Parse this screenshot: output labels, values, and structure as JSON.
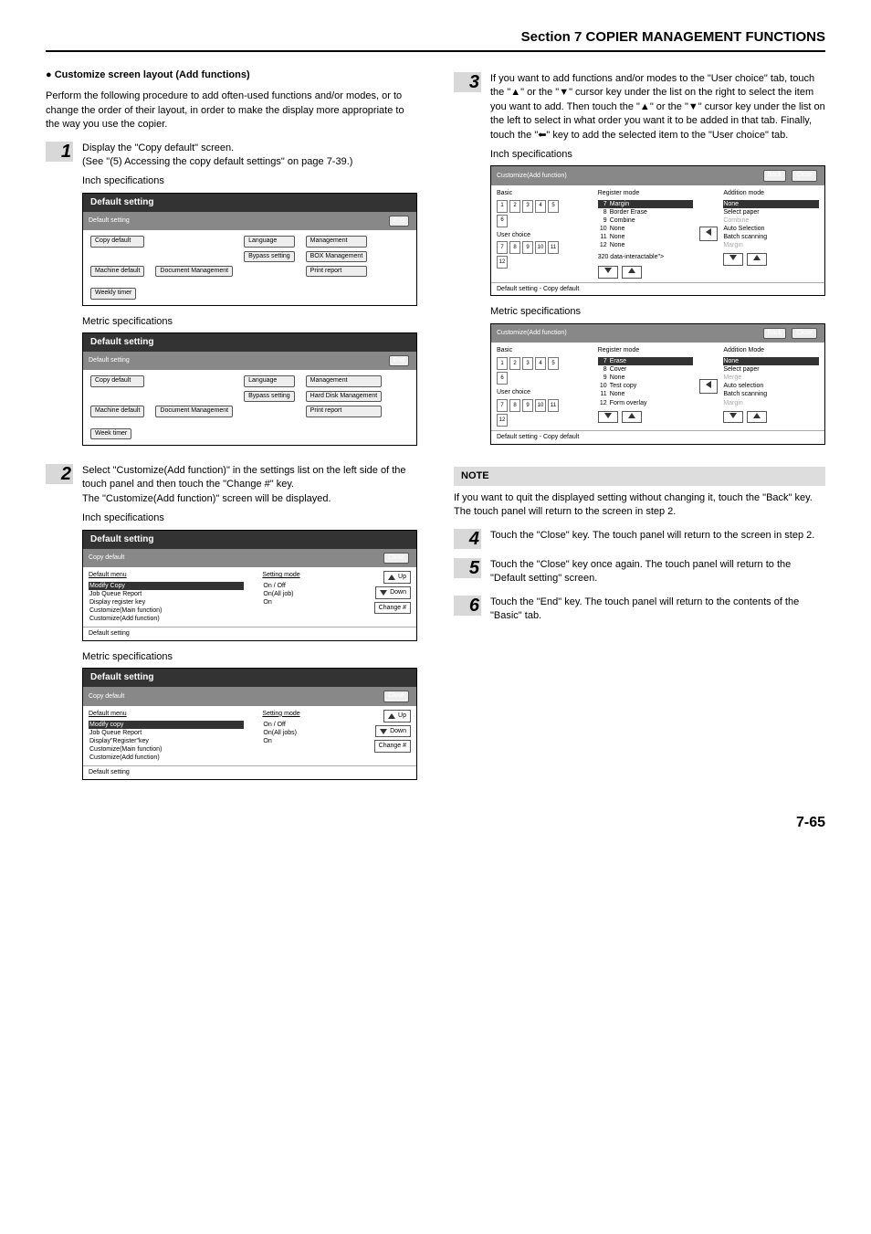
{
  "header": {
    "section_title": "Section 7  COPIER MANAGEMENT FUNCTIONS"
  },
  "left": {
    "heading": "Customize screen layout (Add functions)",
    "intro": "Perform the following procedure to add often-used functions and/or modes, or to change the order of their layout, in order to make the display more appropriate to the way you use the copier.",
    "step1": {
      "num": "1",
      "line1": "Display the \"Copy default\" screen.",
      "line2": "(See \"(5) Accessing the copy default settings\" on page 7-39.)",
      "inch_label": "Inch specifications",
      "metric_label": "Metric specifications"
    },
    "screen_a": {
      "title": "Default setting",
      "bar": "Default setting",
      "end": "End",
      "buttons": {
        "copy_default": "Copy default",
        "language": "Language",
        "bypass": "Bypass setting",
        "management": "Management",
        "box_mgmt": "BOX Management",
        "weekly": "Weekly timer",
        "machine": "Machine default",
        "document": "Document Management",
        "print": "Print report"
      }
    },
    "screen_b": {
      "title": "Default setting",
      "bar": "Default setting",
      "end": "End",
      "buttons": {
        "copy_default": "Copy default",
        "language": "Language",
        "bypass": "Bypass setting",
        "management": "Management",
        "hdd_mgmt": "Hard Disk Management",
        "week": "Week timer",
        "machine": "Machine default",
        "document": "Document Management",
        "print": "Print report"
      }
    },
    "step2": {
      "num": "2",
      "line1": "Select \"Customize(Add function)\" in the settings list on the left side of the touch panel and then touch the \"Change #\" key.",
      "line2": "The \"Customize(Add function)\" screen will be displayed.",
      "inch_label": "Inch specifications",
      "metric_label": "Metric specifications"
    },
    "screen_c": {
      "title": "Default setting",
      "bar": "Copy default",
      "close": "Close",
      "menu_hdr": "Default menu",
      "mode_hdr": "Setting mode",
      "items": [
        {
          "name": "Modify Copy",
          "mode": "On / Off",
          "sel": true
        },
        {
          "name": "Job Queue Report",
          "mode": "On(All job)",
          "sel": false
        },
        {
          "name": "Display register key",
          "mode": "On",
          "sel": false
        },
        {
          "name": "Customize(Main function)",
          "mode": "",
          "sel": false
        },
        {
          "name": "Customize(Add function)",
          "mode": "",
          "sel": false
        }
      ],
      "up": "Up",
      "down": "Down",
      "change": "Change #",
      "footer": "Default setting"
    },
    "screen_d": {
      "title": "Default setting",
      "bar": "Copy default",
      "close": "Close",
      "menu_hdr": "Default menu",
      "mode_hdr": "Setting mode",
      "items": [
        {
          "name": "Modify copy",
          "mode": "On / Off",
          "sel": true
        },
        {
          "name": "Job Queue Report",
          "mode": "On(All jobs)",
          "sel": false
        },
        {
          "name": "Display\"Register\"key",
          "mode": "On",
          "sel": false
        },
        {
          "name": "Customize(Main function)",
          "mode": "",
          "sel": false
        },
        {
          "name": "Customize(Add function)",
          "mode": "",
          "sel": false
        }
      ],
      "up": "Up",
      "down": "Down",
      "change": "Change #",
      "footer": "Default setting"
    }
  },
  "right": {
    "step3": {
      "num": "3",
      "text": "If you want to add functions and/or modes to the \"User choice\" tab, touch the \"▲\" or the \"▼\" cursor key under the list on the right to select the item you want to add. Then touch the \"▲\" or the \"▼\" cursor key under the list on the left to select in what order you want it to be added in that tab. Finally, touch the \"⬅\" key to add the selected item to the \"User choice\" tab.",
      "inch_label": "Inch specifications",
      "metric_label": "Metric specifications"
    },
    "screen_e": {
      "bar": "Customize(Add function)",
      "back": "Back",
      "close": "Close",
      "basic": "Basic",
      "user": "User choice",
      "reg_hdr": "Register mode",
      "add_hdr": "Addition mode",
      "reg": [
        {
          "n": "7",
          "t": "Margin",
          "sel": true
        },
        {
          "n": "8",
          "t": "Border Erase",
          "sel": false
        },
        {
          "n": "9",
          "t": "Combine",
          "sel": false
        },
        {
          "n": "10",
          "t": "None",
          "sel": false
        },
        {
          "n": "11",
          "t": "None",
          "sel": false
        },
        {
          "n": "12",
          "t": "None",
          "sel": false
        }
      ],
      "add": [
        {
          "t": "None",
          "sel": true
        },
        {
          "t": "Select paper",
          "sel": false
        },
        {
          "t": "Combine",
          "dis": true
        },
        {
          "t": "Auto Selection",
          "sel": false
        },
        {
          "t": "Batch scanning",
          "sel": false
        },
        {
          "t": "Margin",
          "dis": true
        }
      ],
      "footer": "Default setting - Copy default"
    },
    "screen_f": {
      "bar": "Customize(Add function)",
      "back": "Back",
      "close": "Close",
      "basic": "Basic",
      "user": "User choice",
      "reg_hdr": "Register mode",
      "add_hdr": "Addition Mode",
      "reg": [
        {
          "n": "7",
          "t": "Erase",
          "sel": true
        },
        {
          "n": "8",
          "t": "Cover",
          "sel": false
        },
        {
          "n": "9",
          "t": "None",
          "sel": false
        },
        {
          "n": "10",
          "t": "Test copy",
          "sel": false
        },
        {
          "n": "11",
          "t": "None",
          "sel": false
        },
        {
          "n": "12",
          "t": "Form overlay",
          "sel": false
        }
      ],
      "add": [
        {
          "t": "None",
          "sel": true
        },
        {
          "t": "Select paper",
          "sel": false
        },
        {
          "t": "Merge",
          "dis": true
        },
        {
          "t": "Auto selection",
          "sel": false
        },
        {
          "t": "Batch scanning",
          "sel": false
        },
        {
          "t": "Margin",
          "dis": true
        }
      ],
      "footer": "Default setting - Copy default"
    },
    "note_label": "NOTE",
    "note_text": "If you want to quit the displayed setting without changing it, touch the \"Back\" key. The touch panel will return to the screen in step 2.",
    "step4": {
      "num": "4",
      "text": "Touch the \"Close\" key. The touch panel will return to the screen in step 2."
    },
    "step5": {
      "num": "5",
      "text": "Touch the \"Close\" key once again. The touch panel will return to the \"Default setting\" screen."
    },
    "step6": {
      "num": "6",
      "text": "Touch the \"End\" key. The touch panel will return to the contents of the \"Basic\" tab."
    }
  },
  "page_number": "7-65"
}
